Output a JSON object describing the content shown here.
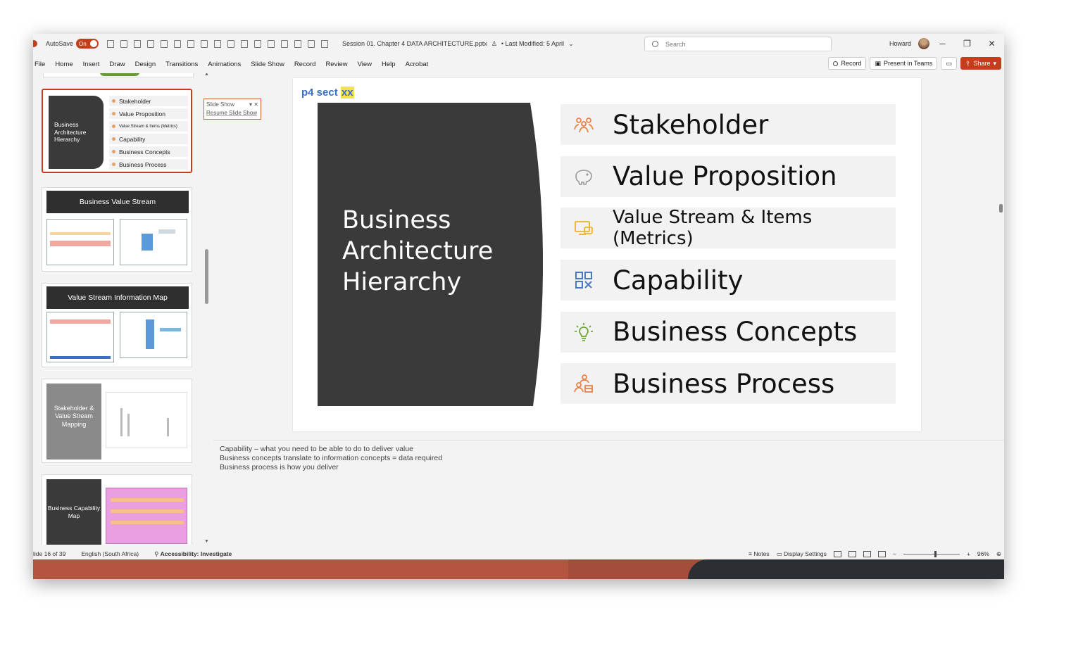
{
  "titlebar": {
    "autosave_label": "AutoSave",
    "autosave_state": "On",
    "doc_name": "Session 01. Chapter 4 DATA ARCHITECTURE.pptx",
    "last_modified": "• Last Modified: 5 April",
    "search_placeholder": "Search",
    "user_name": "Howard"
  },
  "menu": [
    "File",
    "Home",
    "Insert",
    "Draw",
    "Design",
    "Transitions",
    "Animations",
    "Slide Show",
    "Record",
    "Review",
    "View",
    "Help",
    "Acrobat"
  ],
  "ribbon_buttons": {
    "record": "Record",
    "present": "Present in Teams",
    "share": "Share"
  },
  "popup": {
    "title": "Slide Show",
    "action": "Resume Slide Show"
  },
  "thumbnails": {
    "t1": {
      "title": "Business Architecture Hierarchy",
      "items": [
        "Stakeholder",
        "Value Proposition",
        "Value Stream & Items (Metrics)",
        "Capability",
        "Business Concepts",
        "Business Process"
      ]
    },
    "t2": {
      "title": "Business Value Stream"
    },
    "t3": {
      "title": "Value Stream Information Map"
    },
    "t4": {
      "title": "Stakeholder & Value Stream Mapping"
    },
    "t5": {
      "title": "Business Capability Map"
    }
  },
  "slide": {
    "section_prefix": "p4 sect",
    "section_highlight": "xx",
    "title_lines": [
      "Business",
      "Architecture",
      "Hierarchy"
    ],
    "items": [
      {
        "label": "Stakeholder",
        "icon": "people-icon",
        "color": "#e8834a"
      },
      {
        "label": "Value Proposition",
        "icon": "piggy-bank-icon",
        "color": "#9a9a9a"
      },
      {
        "label": "Value Stream & Items (Metrics)",
        "icon": "display-chat-icon",
        "color": "#e8b530"
      },
      {
        "label": "Capability",
        "icon": "grid-icon",
        "color": "#4a78c2"
      },
      {
        "label": "Business Concepts",
        "icon": "lightbulb-icon",
        "color": "#6fa83a"
      },
      {
        "label": "Business Process",
        "icon": "team-process-icon",
        "color": "#e8834a"
      }
    ]
  },
  "notes": [
    "Capability – what you need to be able to do to deliver value",
    "Business concepts translate to information concepts = data required",
    "Business process is how you deliver"
  ],
  "status": {
    "slide_count": "lide 16 of 39",
    "language": "English (South Africa)",
    "accessibility": "Accessibility: Investigate",
    "notes_btn": "Notes",
    "display_settings": "Display Settings",
    "zoom": "96%"
  }
}
